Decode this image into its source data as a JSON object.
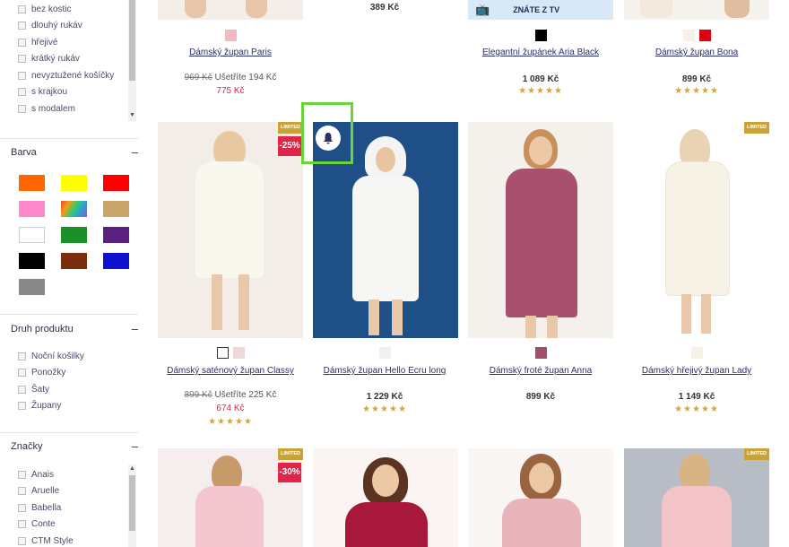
{
  "filters": {
    "properties": [
      "bez kostic",
      "dlouhý rukáv",
      "hřejivé",
      "krátký rukáv",
      "nevyztužené košíčky",
      "s krajkou",
      "s modalem"
    ],
    "color_section": {
      "title": "Barva",
      "toggle": "–"
    },
    "colors": [
      "#ff6600",
      "#ffff00",
      "#ff0000",
      "#ff88cc",
      "multicolor",
      "#c9a56a",
      "#ffffff",
      "#1a8f2a",
      "#5a2080",
      "#000000",
      "#7a2e10",
      "#1010d0",
      "#888888"
    ],
    "product_type_section": {
      "title": "Druh produktu",
      "toggle": "–"
    },
    "product_types": [
      "Noční košilky",
      "Ponožky",
      "Šaty",
      "Župany"
    ],
    "brand_section": {
      "title": "Značky",
      "toggle": "–"
    },
    "brands": [
      "Anais",
      "Aruelle",
      "Babella",
      "Conte",
      "CTM Style"
    ]
  },
  "top_row": {
    "p1": {
      "name": "Dámský župan Paris",
      "old_price": "969 Kč",
      "savings": "Ušetříte 194 Kč",
      "price": "775 Kč",
      "swatches": [
        "#f4b8c0"
      ]
    },
    "p2": {
      "price": "389 Kč"
    },
    "p3": {
      "name": "Elegantní župánek Aria Black",
      "price": "1 089 Kč",
      "stars": "★★★★★",
      "swatches": [
        "#000000"
      ],
      "banner": "ZNÁTE Z TV"
    },
    "p4": {
      "name": "Dámský župan Bona",
      "price": "899 Kč",
      "stars": "★★★★★",
      "swatches": [
        "#f8f0ea",
        "#e00010"
      ]
    }
  },
  "middle_row": {
    "p1": {
      "name": "Dámský saténový župan Classy",
      "old_price": "899 Kč",
      "savings": "Ušetříte 225 Kč",
      "price": "674 Kč",
      "stars": "★★★★★",
      "badge_limited": "LIMITED",
      "badge_discount": "-25%",
      "swatches": [
        "#ffffff",
        "#f0d8d8"
      ]
    },
    "p2": {
      "name": "Dámský župan Hello Ecru long",
      "price": "1 229 Kč",
      "stars": "★★★★★",
      "swatches": [
        "#f0f0f0"
      ]
    },
    "p3": {
      "name": "Dámský froté župan Anna",
      "price": "899 Kč",
      "swatches": [
        "#a0506a"
      ]
    },
    "p4": {
      "name": "Dámský hřejivý župan Lady",
      "price": "1 149 Kč",
      "stars": "★★★★★",
      "badge_limited": "LIMITED",
      "swatches": [
        "#f6f2e8"
      ]
    }
  },
  "bottom_row": {
    "p1": {
      "badge_limited": "LIMITED",
      "badge_discount": "-30%"
    },
    "p4": {
      "badge_limited": "LIMITED"
    }
  },
  "icons": {
    "tv": "tv-icon",
    "bell": "bell-icon"
  }
}
